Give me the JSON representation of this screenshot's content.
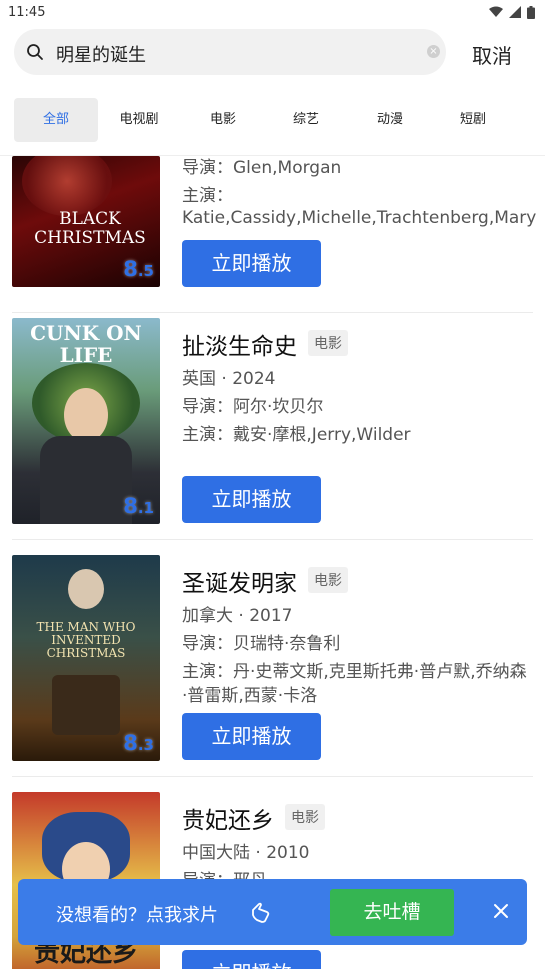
{
  "status_bar": {
    "time": "11:45"
  },
  "search": {
    "query": "明星的诞生",
    "cancel_label": "取消"
  },
  "tabs": [
    {
      "label": "全部"
    },
    {
      "label": "电视剧"
    },
    {
      "label": "电影"
    },
    {
      "label": "综艺"
    },
    {
      "label": "动漫"
    },
    {
      "label": "短剧"
    }
  ],
  "results": [
    {
      "title": "",
      "director": "导演：Glen,Morgan",
      "cast_label": "主演：",
      "cast": "Katie,Cassidy,Michelle,Trachtenberg,Mary",
      "score_int": "8",
      "score_dec": ".5",
      "poster_text": "BLACK CHRISTMAS",
      "play_label": "立即播放"
    },
    {
      "title": "扯淡生命史",
      "type": "电影",
      "region_year": "英国 · 2024",
      "director": "导演：阿尔·坎贝尔",
      "cast": "主演：戴安·摩根,Jerry,Wilder",
      "score_int": "8",
      "score_dec": ".1",
      "poster_text": "CUNK ON LIFE",
      "play_label": "立即播放"
    },
    {
      "title": "圣诞发明家",
      "type": "电影",
      "region_year": "加拿大 · 2017",
      "director": "导演：贝瑞特·奈鲁利",
      "cast": "主演：丹·史蒂文斯,克里斯托弗·普卢默,乔纳森·普雷斯,西蒙·卡洛",
      "score_int": "8",
      "score_dec": ".3",
      "poster_text": "THE MAN WHO INVENTED CHRISTMAS",
      "play_label": "立即播放"
    },
    {
      "title": "贵妃还乡",
      "type": "电影",
      "region_year": "中国大陆 · 2010",
      "director": "导演：邢丹",
      "poster_text": "贵妃还乡",
      "play_label": "立即播放"
    }
  ],
  "feedback": {
    "text": "没想看的？点我求片",
    "button_label": "去吐槽"
  },
  "colors": {
    "accent": "#2f6fe4",
    "green": "#35b552"
  }
}
